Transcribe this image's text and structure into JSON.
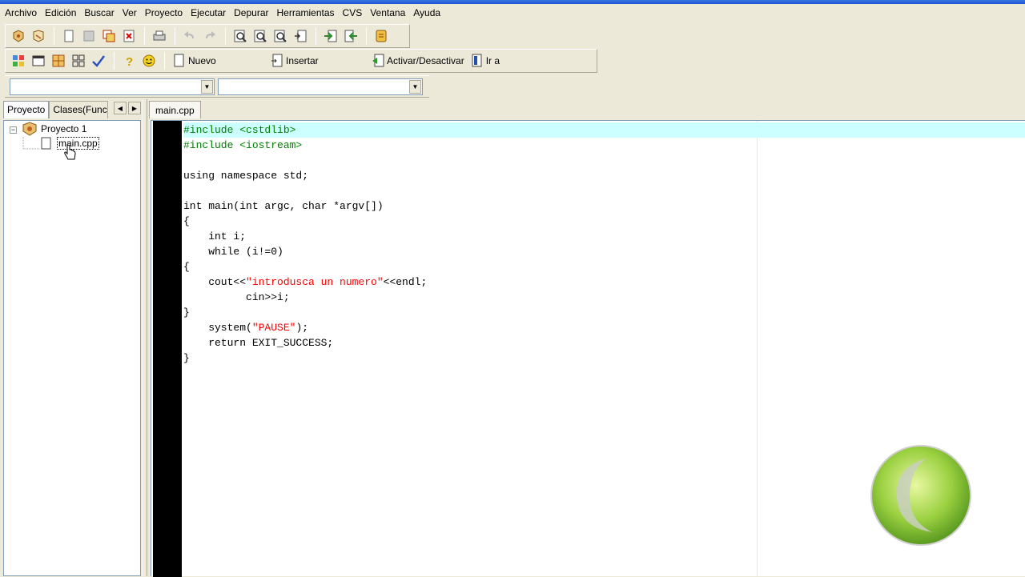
{
  "menu": [
    "Archivo",
    "Edición",
    "Buscar",
    "Ver",
    "Proyecto",
    "Ejecutar",
    "Depurar",
    "Herramientas",
    "CVS",
    "Ventana",
    "Ayuda"
  ],
  "toolbar2": {
    "new_label": "Nuevo",
    "insert_label": "Insertar",
    "toggle_label": "Activar/Desactivar",
    "goto_label": "Ir a"
  },
  "combos": {
    "class_value": "",
    "member_value": ""
  },
  "left_panel": {
    "tabs": [
      "Proyecto",
      "Clases(Funcic"
    ],
    "tree": {
      "project": "Proyecto 1",
      "file": "main.cpp"
    }
  },
  "editor": {
    "tab": "main.cpp",
    "lines": [
      "#include <cstdlib>",
      "#include <iostream>",
      "",
      "using namespace std;",
      "",
      "int main(int argc, char *argv[])",
      "{",
      "    int i;",
      "    while (i!=0)",
      "{",
      "    cout<<\"introdusca un numero\"<<endl;",
      "          cin>>i;",
      "}",
      "    system(\"PAUSE\");",
      "    return EXIT_SUCCESS;",
      "}"
    ]
  },
  "colors": {
    "highlight_line": "#ccffff",
    "directive": "#008000",
    "string": "#ff0000",
    "gutter": "#000000"
  }
}
